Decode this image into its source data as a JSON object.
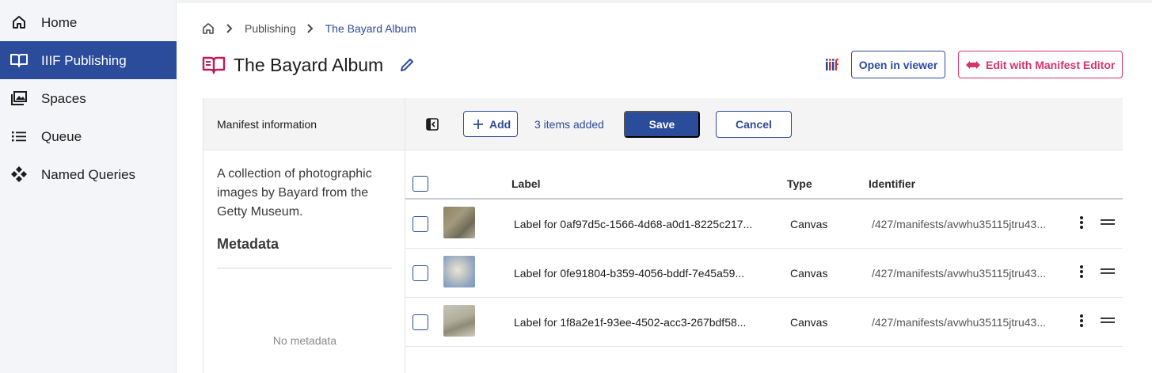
{
  "sidebar": {
    "items": [
      {
        "label": "Home",
        "icon": "home-icon"
      },
      {
        "label": "IIIF Publishing",
        "icon": "book-open-icon",
        "active": true
      },
      {
        "label": "Spaces",
        "icon": "images-icon"
      },
      {
        "label": "Queue",
        "icon": "list-icon"
      },
      {
        "label": "Named Queries",
        "icon": "diamond-dots-icon"
      }
    ]
  },
  "breadcrumb": {
    "items": [
      "Publishing",
      "The Bayard Album"
    ]
  },
  "header": {
    "title": "The Bayard Album",
    "open_viewer_label": "Open in viewer",
    "edit_manifest_label": "Edit with Manifest Editor"
  },
  "left_panel": {
    "header": "Manifest information",
    "description": "A collection of photographic images by Bayard from the Getty Museum.",
    "metadata_title": "Metadata",
    "no_metadata": "No metadata"
  },
  "toolbar": {
    "add_label": "Add",
    "items_added": "3 items added",
    "save_label": "Save",
    "cancel_label": "Cancel"
  },
  "table": {
    "columns": [
      "Label",
      "Type",
      "Identifier"
    ],
    "rows": [
      {
        "label": "Label for 0af97d5c-1566-4d68-a0d1-8225c217...",
        "type": "Canvas",
        "identifier": "/427/manifests/avwhu35115jtru43..."
      },
      {
        "label": "Label for 0fe91804-b359-4056-bddf-7e45a59...",
        "type": "Canvas",
        "identifier": "/427/manifests/avwhu35115jtru43..."
      },
      {
        "label": "Label for 1f8a2e1f-93ee-4502-acc3-267bdf58...",
        "type": "Canvas",
        "identifier": "/427/manifests/avwhu35115jtru43..."
      }
    ]
  },
  "colors": {
    "primary": "#2b4b9b",
    "accent": "#d6336c"
  }
}
